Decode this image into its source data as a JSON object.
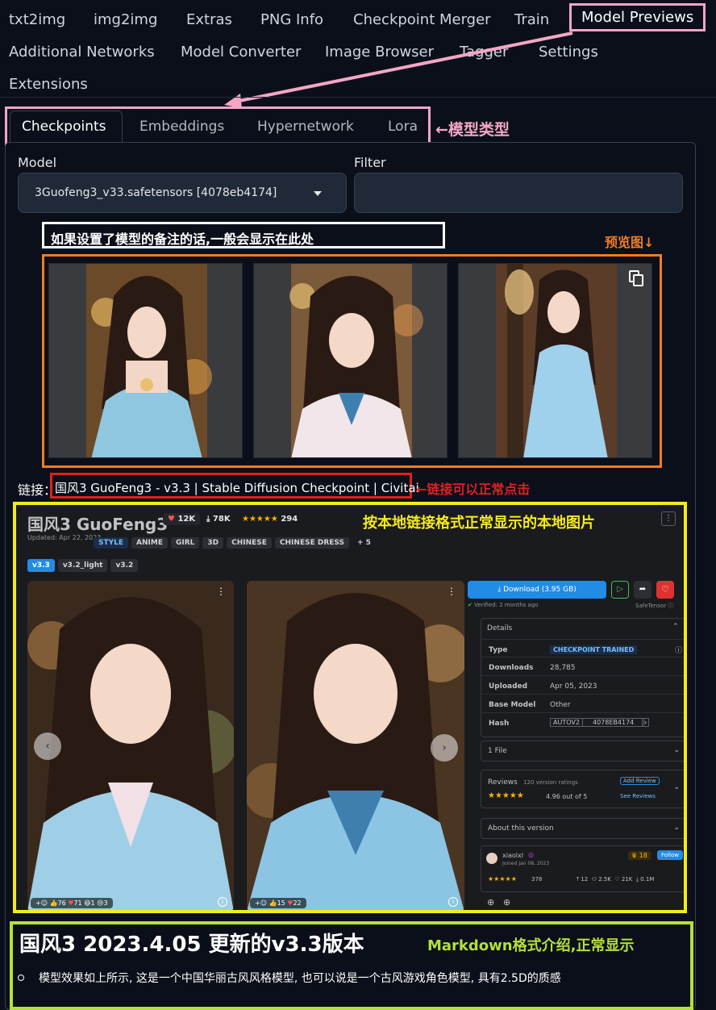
{
  "top_tabs": [
    "txt2img",
    "img2img",
    "Extras",
    "PNG Info",
    "Checkpoint Merger",
    "Train",
    "Model Previews",
    "Additional Networks",
    "Model Converter",
    "Image Browser",
    "Tagger",
    "Settings",
    "Extensions"
  ],
  "sub_tabs": [
    "Checkpoints",
    "Embeddings",
    "Hypernetwork",
    "Lora"
  ],
  "annotations": {
    "model_types": "←模型类型",
    "preview_images": "预览图↓",
    "link_clickable": "←链接可以正常点击",
    "local_image": "按本地链接格式正常显示的本地图片",
    "markdown": "Markdown格式介绍,正常显示"
  },
  "model": {
    "label": "Model",
    "value": "3Guofeng3_v33.safetensors [4078eb4174]"
  },
  "filter": {
    "label": "Filter",
    "value": ""
  },
  "note_text": "如果设置了模型的备注的话,一般会显示在此处",
  "link": {
    "prefix": "链接：",
    "text": "国风3 GuoFeng3 - v3.3 | Stable Diffusion Checkpoint | Civitai"
  },
  "civitai": {
    "title": "国风3 GuoFeng3",
    "likes": "12K",
    "downloads": "78K",
    "rating_count": "294",
    "updated": "Updated: Apr 22, 2023",
    "tags": [
      "STYLE",
      "ANIME",
      "GIRL",
      "3D",
      "CHINESE",
      "CHINESE DRESS",
      "+ 5"
    ],
    "versions": [
      "v3.3",
      "v3.2_light",
      "v3.2"
    ],
    "download_button": "Download (3.95 GB)",
    "verified": "Verified: 2 months ago",
    "safetensor": "SafeTensor",
    "details_title": "Details",
    "details": [
      {
        "key": "Type",
        "value": "CHECKPOINT TRAINED"
      },
      {
        "key": "Downloads",
        "value": "28,785"
      },
      {
        "key": "Uploaded",
        "value": "Apr 05, 2023"
      },
      {
        "key": "Base Model",
        "value": "Other"
      },
      {
        "key": "Hash",
        "value": "AUTOV2"
      }
    ],
    "hash_value": "4078EB4174",
    "files": "1 File",
    "reviews_title": "Reviews",
    "reviews_count": "120 version ratings",
    "reviews_score": "4.96 out of 5",
    "add_review": "Add Review",
    "see_reviews": "See Reviews",
    "about": "About this version",
    "author": "xiaolxl",
    "joined": "Joined Jan 08, 2023",
    "author_rank": "18",
    "follow": "Follow",
    "author_rating": "378",
    "author_stats": [
      "12",
      "2.5K",
      "21K",
      "0.1M"
    ],
    "img1_reactions": [
      "76",
      "71",
      "1",
      "3"
    ],
    "img2_reactions": [
      "15",
      "22"
    ]
  },
  "markdown": {
    "heading": "国风3 2023.4.05 更新的v3.3版本",
    "bullet": "模型效果如上所示, 这是一个中国华丽古风风格模型, 也可以说是一个古风游戏角色模型, 具有2.5D的质感"
  },
  "colors": {
    "pink": "#f4a6c6",
    "orange": "#f07d23",
    "red": "#e02020",
    "yellow": "#f5ea1a",
    "green": "#b5e03a",
    "civitai_blue": "#228be6"
  }
}
